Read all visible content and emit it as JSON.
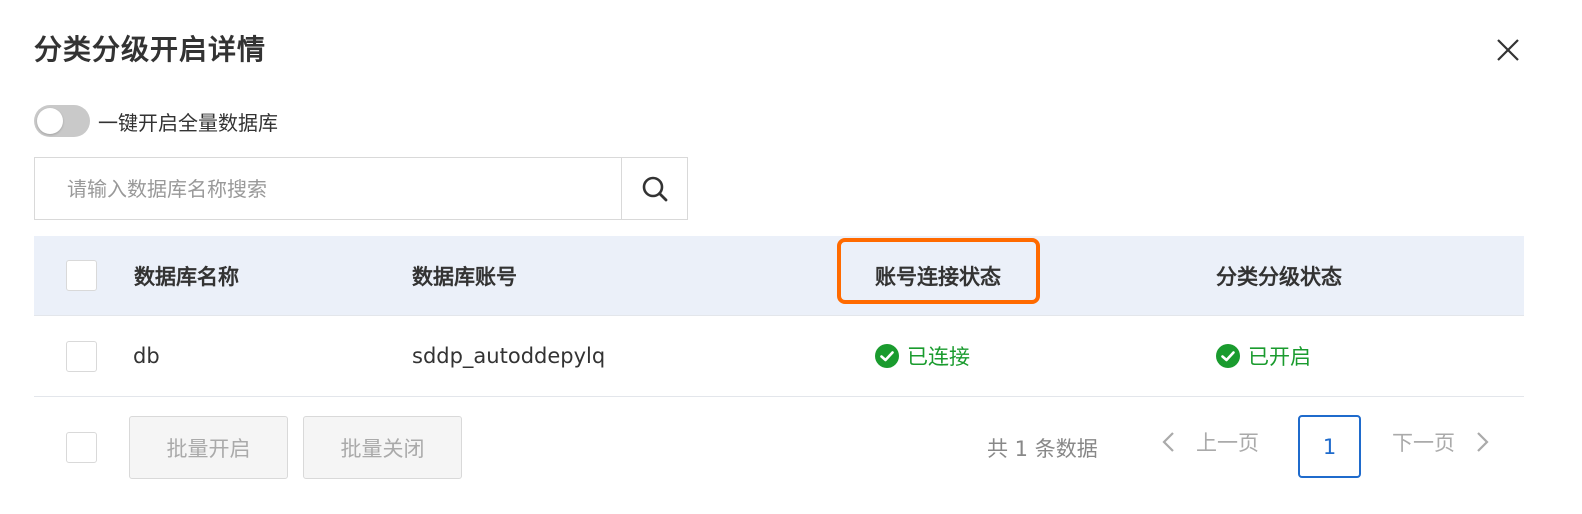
{
  "dialog": {
    "title": "分类分级开启详情"
  },
  "toggle": {
    "label": "一键开启全量数据库",
    "enabled": false
  },
  "search": {
    "placeholder": "请输入数据库名称搜索",
    "value": ""
  },
  "table": {
    "columns": [
      "数据库名称",
      "数据库账号",
      "账号连接状态",
      "分类分级状态"
    ],
    "rows": [
      {
        "db_name": "db",
        "account": "sddp_autoddepylq",
        "connection_status": "已连接",
        "classification_status": "已开启"
      }
    ]
  },
  "footer": {
    "batch_enable": "批量开启",
    "batch_disable": "批量关闭"
  },
  "pagination": {
    "total_text": "共 1 条数据",
    "prev": "上一页",
    "next": "下一页",
    "current_page": "1"
  },
  "colors": {
    "highlight": "#ff6a00",
    "success": "#1a9b2e",
    "primary": "#1f6bcc",
    "header_bg": "#ebf0f9"
  },
  "icons": {
    "close": "close-icon",
    "search": "search-icon",
    "success": "check-circle-icon",
    "prev": "chevron-left-icon",
    "next": "chevron-right-icon"
  }
}
